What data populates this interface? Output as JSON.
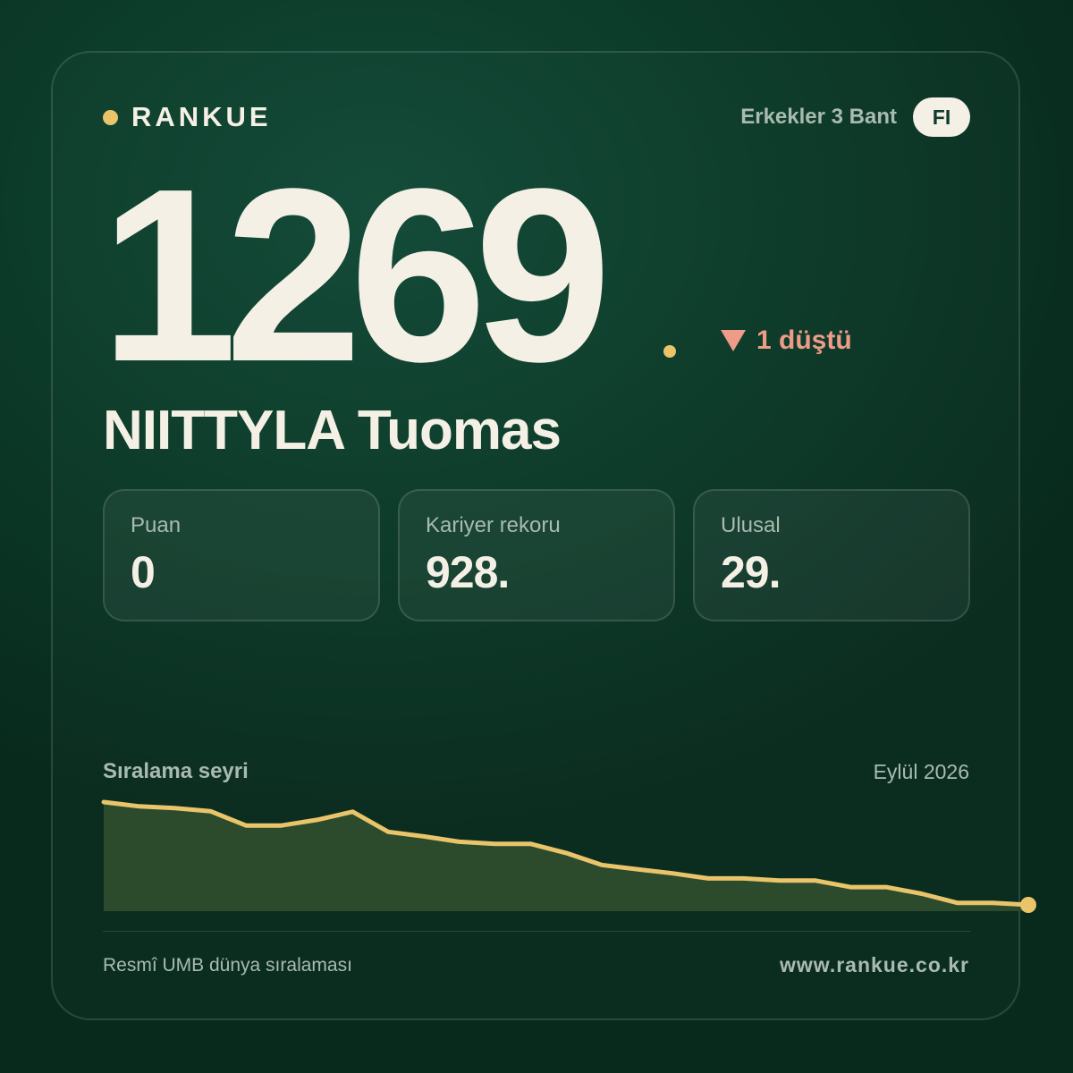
{
  "brand": {
    "name": "RANKUE",
    "accent_color": "#e9c46a"
  },
  "header": {
    "category": "Erkekler 3 Bant",
    "country_code": "FI"
  },
  "ranking": {
    "rank": "1269",
    "change_text": "1 düştü",
    "change_direction": "down",
    "change_icon": "triangle-down-icon",
    "change_color": "#ee9b88"
  },
  "player": {
    "name": "NIITTYLA Tuomas"
  },
  "stats": [
    {
      "label": "Puan",
      "value": "0"
    },
    {
      "label": "Kariyer rekoru",
      "value": "928."
    },
    {
      "label": "Ulusal",
      "value": "29."
    }
  ],
  "trend": {
    "title": "Sıralama seyri",
    "period": "Eylül 2026"
  },
  "chart_data": {
    "type": "area",
    "y_inverted": true,
    "line_color": "#e9c46a",
    "fill_color": "#2c4a2c",
    "grid": false,
    "series": [
      {
        "values": [
          80,
          165,
          200,
          260,
          540,
          540,
          430,
          270,
          665,
          755,
          860,
          900,
          900,
          1080,
          1315,
          1400,
          1480,
          1580,
          1580,
          1620,
          1620,
          1750,
          1750,
          1880,
          2060,
          2060,
          2100
        ]
      }
    ]
  },
  "footer": {
    "source": "Resmî UMB dünya sıralaması",
    "url": "www.rankue.co.kr"
  }
}
